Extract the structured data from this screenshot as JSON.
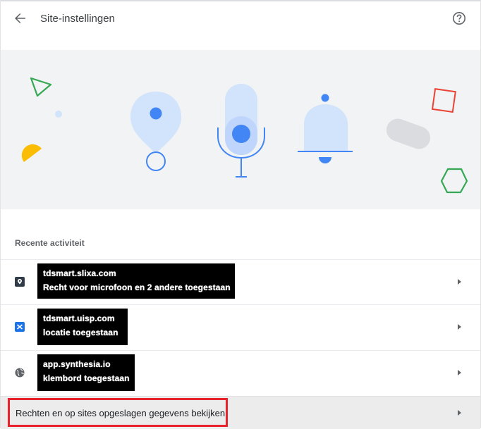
{
  "header": {
    "title": "Site-instellingen",
    "back_icon": "arrow-left-icon",
    "help_icon": "help-circle-icon"
  },
  "illustration": {
    "icons": [
      "location-pin-icon",
      "microphone-icon",
      "notification-bell-icon"
    ],
    "colors": {
      "blue": "#4285f4",
      "light_blue": "#d2e3fc",
      "green": "#34a853",
      "red": "#ea4335",
      "yellow": "#fbbc04",
      "grey": "#dadce0"
    }
  },
  "recent_activity": {
    "title": "Recente activiteit",
    "items": [
      {
        "site": "tdsmart.slixa.com",
        "status": "Recht voor microfoon en 2 andere toegestaan",
        "icon": "site-favicon-icon"
      },
      {
        "site": "tdsmart.uisp.com",
        "status": "locatie toegestaan",
        "icon": "site-favicon-icon"
      },
      {
        "site": "app.synthesia.io",
        "status": "klembord toegestaan",
        "icon": "globe-icon"
      }
    ]
  },
  "footer_link": {
    "label": "Rechten en op sites opgeslagen gegevens bekijken",
    "highlight_color": "#e8212a"
  }
}
